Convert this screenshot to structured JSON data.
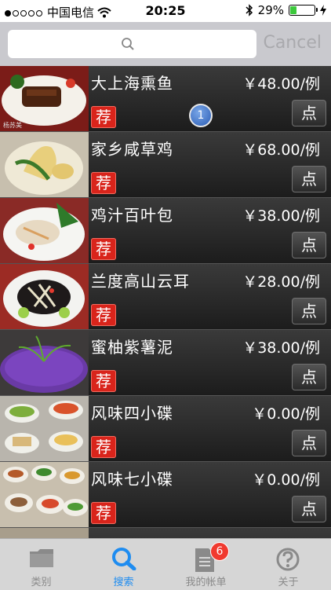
{
  "status_bar": {
    "carrier": "中国电信",
    "time": "20:25",
    "battery_percent": "29%",
    "battery_level": 0.29,
    "signal_dots_filled": 1,
    "signal_dots_total": 5
  },
  "search": {
    "placeholder": "",
    "value": "",
    "cancel_label": "Cancel"
  },
  "menu": {
    "recommend_tag": "荐",
    "order_label": "点",
    "items": [
      {
        "name": "大上海熏鱼",
        "price": "￥48.00/例",
        "selected_count": "1"
      },
      {
        "name": "家乡咸草鸡",
        "price": "￥68.00/例"
      },
      {
        "name": "鸡汁百叶包",
        "price": "￥38.00/例"
      },
      {
        "name": "兰度高山云耳",
        "price": "￥28.00/例"
      },
      {
        "name": "蜜柚紫薯泥",
        "price": "￥38.00/例"
      },
      {
        "name": "风味四小碟",
        "price": "￥0.00/例"
      },
      {
        "name": "风味七小碟",
        "price": "￥0.00/例"
      }
    ]
  },
  "tabbar": {
    "tabs": [
      {
        "label": "类别",
        "icon": "folder-icon"
      },
      {
        "label": "搜索",
        "icon": "search-icon"
      },
      {
        "label": "我的帐单",
        "icon": "document-icon",
        "badge": "6"
      },
      {
        "label": "关于",
        "icon": "help-icon"
      }
    ],
    "active_index": 1
  },
  "colors": {
    "accent": "#1e8cf0",
    "recommend_red": "#d9241b",
    "badge_red": "#f03a2f",
    "row_dark": "#2a2a2a"
  }
}
